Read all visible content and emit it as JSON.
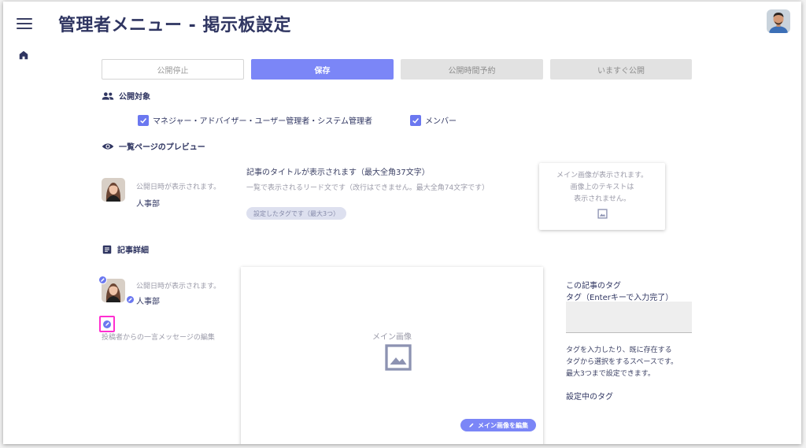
{
  "header": {
    "title": "管理者メニュー - 掲示板設定"
  },
  "toolbar": {
    "unpublish_label": "公開停止",
    "save_label": "保存",
    "schedule_label": "公開時間予約",
    "publish_now_label": "いますぐ公開"
  },
  "audience": {
    "heading": "公開対象",
    "options": [
      {
        "label": "マネジャー・アドバイザー・ユーザー管理者・システム管理者",
        "checked": true
      },
      {
        "label": "メンバー",
        "checked": true
      }
    ]
  },
  "preview": {
    "heading": "一覧ページのプレビュー",
    "date_text": "公開日時が表示されます。",
    "department": "人事部",
    "title_text": "記事のタイトルが表示されます（最大全角37文字）",
    "lead_text": "一覧で表示されるリード文です（改行はできません。最大全角74文字です）",
    "tag_text": "設定したタグです（最大3つ）",
    "image_card_lines": [
      "メイン画像が表示されます。",
      "画像上のテキストは",
      "表示されません。"
    ]
  },
  "detail": {
    "heading": "記事詳細",
    "date_text": "公開日時が表示されます。",
    "department": "人事部",
    "message_edit_text": "投稿者からの一言メッセージの編集",
    "main_image_label": "メイン画像",
    "edit_main_image_label": "メイン画像を編集"
  },
  "tags_panel": {
    "title": "この記事のタグ",
    "input_label": "タグ（Enterキーで入力完了）",
    "hint_lines": [
      "タグを入力したり、既に存在する",
      "タグから選択をするスペースです。",
      "最大3つまで設定できます。"
    ],
    "current_tags_label": "設定中のタグ"
  },
  "colors": {
    "primary": "#7b86f7",
    "navy": "#2f3561",
    "highlight": "#ff2fd0"
  }
}
